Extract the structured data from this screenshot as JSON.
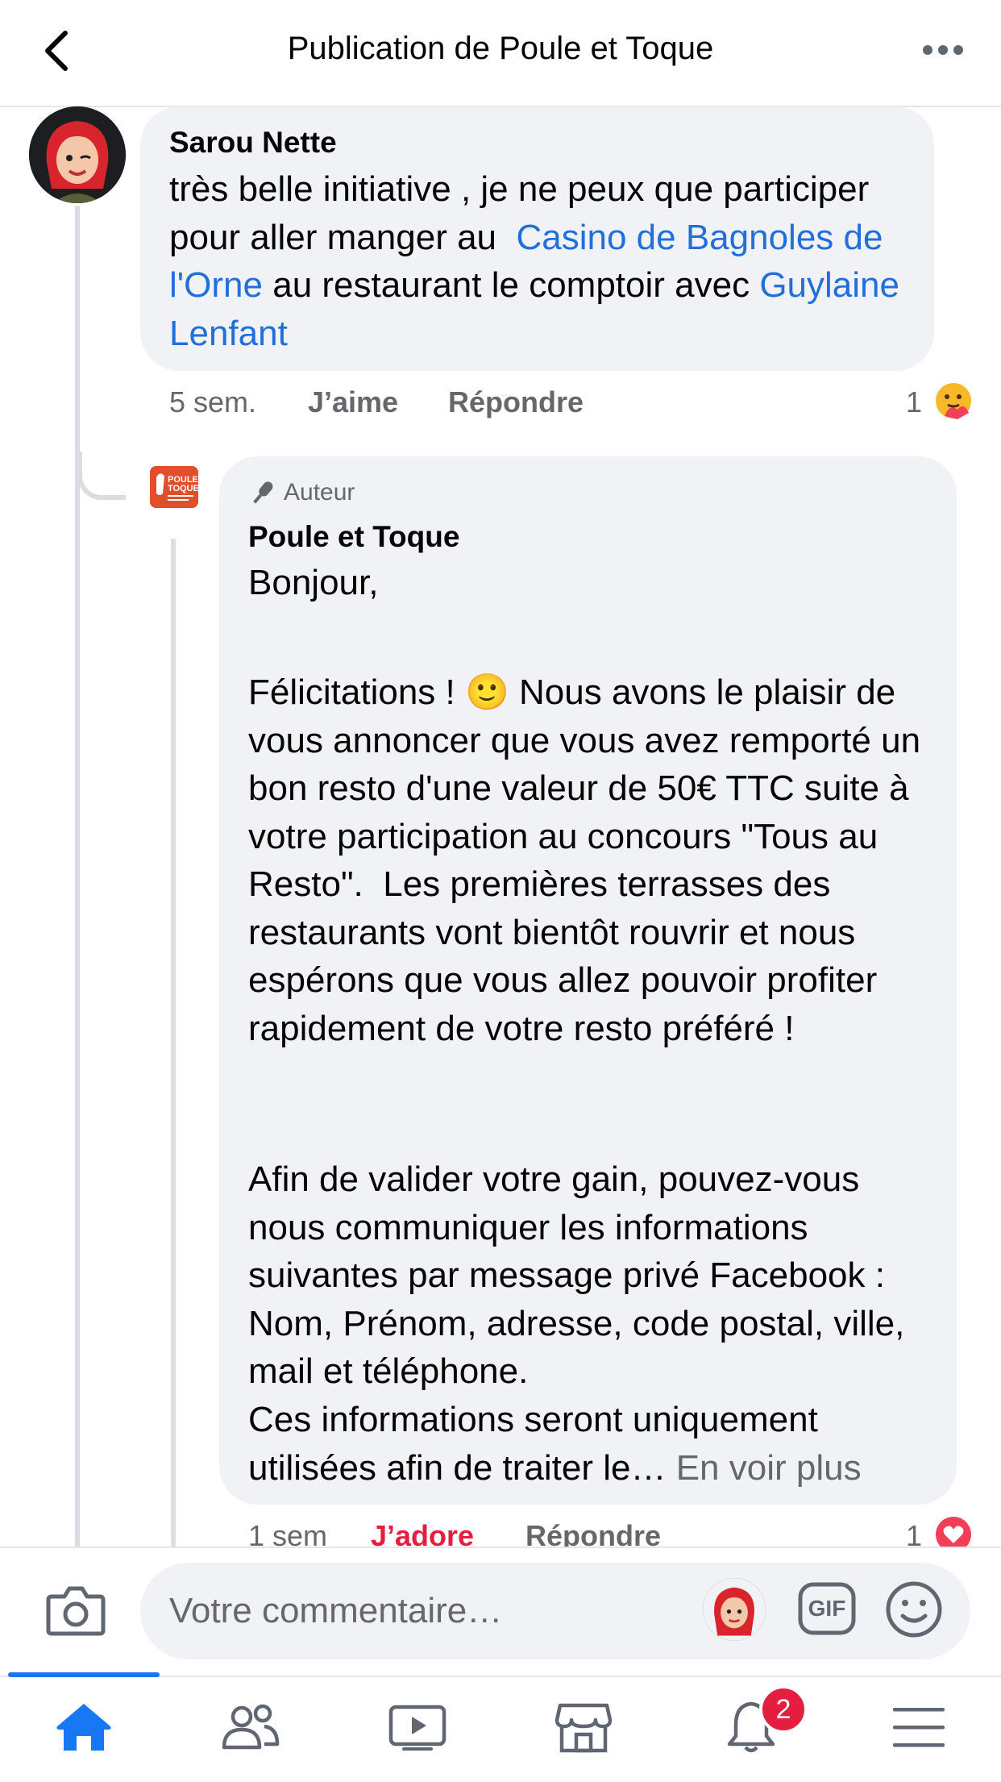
{
  "header": {
    "title": "Publication de Poule et Toque"
  },
  "comments": [
    {
      "author": "Sarou Nette",
      "text_before": "très belle initiative , je ne peux que participer pour aller manger au  ",
      "mention1": "Casino de Bagnoles de l'Orne",
      "text_middle": " au restaurant le comptoir avec ",
      "mention2": "Guylaine Lenfant",
      "time": "5 sem.",
      "like_label": "J’aime",
      "reply_label": "Répondre",
      "reaction_count": "1",
      "reaction_icon": "care-emoji-icon"
    },
    {
      "badge": "Auteur",
      "author": "Poule et Toque",
      "p1": "Bonjour,",
      "p2_before": "Félicitations ! ",
      "p2_emoji": "🙂",
      "p2_after": " Nous avons le plaisir de vous annoncer que vous avez remporté un bon resto d'une valeur de 50€ TTC suite à votre participation au concours \"Tous au Resto\".  Les premières terrasses des restaurants vont bientôt rouvrir et nous espérons que vous allez pouvoir profiter rapidement de votre resto préféré !",
      "p3": "Afin de valider votre gain, pouvez-vous nous communiquer les informations suivantes par message privé Facebook : Nom, Prénom, adresse, code postal, ville, mail et téléphone.",
      "p4": "Ces informations seront uniquement utilisées afin de traiter le…",
      "see_more": "En voir plus",
      "time": "1 sem",
      "like_label": "J’adore",
      "reply_label": "Répondre",
      "reaction_count": "1",
      "reaction_icon": "heart-icon",
      "logo_text": "POULE TOQUE"
    }
  ],
  "composer": {
    "placeholder": "Votre commentaire…",
    "gif_label": "GIF"
  },
  "tabbar": {
    "active": "home",
    "notification_count": "2",
    "items": [
      "home",
      "friends",
      "watch",
      "marketplace",
      "notifications",
      "menu"
    ]
  },
  "colors": {
    "accent": "#1877f2",
    "mention": "#216fdb",
    "love": "#e41e3f",
    "bubble": "#f0f2f5"
  }
}
